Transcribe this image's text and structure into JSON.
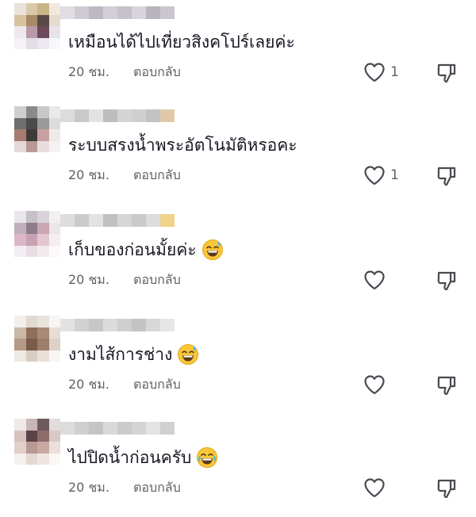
{
  "comments": [
    {
      "text": "เหมือนได้ไปเที่ยวสิงคโปร์เลยค่ะ",
      "time": "20 ชม.",
      "reply_label": "ตอบกลับ",
      "like_count": "1",
      "emoji": "",
      "avatar_colors": [
        "#e8e2d8",
        "#d9c9a8",
        "#c9b487",
        "#efe9df",
        "#d8c39c",
        "#a88a66",
        "#5a4a46",
        "#e6dbd0",
        "#efe8ee",
        "#b89aa8",
        "#6d4a5c",
        "#e8e3ea",
        "#f4f2f6",
        "#e3dde8",
        "#ece8f0",
        "#f8f7fa"
      ],
      "username_colors": [
        "#e0dde3",
        "#cfcad4",
        "#bdb8c2",
        "#d2cdd6",
        "#c6c1ca",
        "#d8d4dc",
        "#b9b4be",
        "#cac6ce"
      ]
    },
    {
      "text": "ระบบสรงน้ำพระอัตโนมัติหรอคะ",
      "time": "20 ชม.",
      "reply_label": "ตอบกลับ",
      "like_count": "1",
      "emoji": "",
      "avatar_colors": [
        "#cfcfcf",
        "#8a8a8a",
        "#c8c8c8",
        "#e9e9e9",
        "#6e6e6e",
        "#4a4a4a",
        "#9a9a9a",
        "#dcdcdc",
        "#a67c6e",
        "#3e3a3a",
        "#c9a0a0",
        "#efeaea",
        "#e6d8d8",
        "#b79a96",
        "#e9dede",
        "#f6f2f2"
      ],
      "username_colors": [
        "#dcdcdc",
        "#c9c9c9",
        "#e3e3e3",
        "#bdbdbd",
        "#d4d4d4",
        "#cfcfcf",
        "#c2c2c2",
        "#e0c9a8"
      ]
    },
    {
      "text": "เก็บของก่อนมั้ยค่ะ",
      "time": "20 ชม.",
      "reply_label": "ตอบกลับ",
      "like_count": "",
      "emoji": "sweat-smile",
      "avatar_colors": [
        "#e9e6ea",
        "#c7c0c8",
        "#d8d2d9",
        "#f2eff3",
        "#bfb1bc",
        "#8e7c8c",
        "#c9a7b4",
        "#ece5ea",
        "#d9b7c4",
        "#c8a2b2",
        "#e4c6d1",
        "#f4eef1",
        "#f3eef1",
        "#e8dde3",
        "#f1ebee",
        "#fbf9fa"
      ],
      "username_colors": [
        "#dddddd",
        "#cbcbcb",
        "#e2e2e2",
        "#c0c0c0",
        "#d6d6d6",
        "#cacaca",
        "#dcdcdc",
        "#f1d28a"
      ]
    },
    {
      "text": "งามไส้การช่าง",
      "time": "20 ชม.",
      "reply_label": "ตอบกลับ",
      "like_count": "",
      "emoji": "sweat-smile",
      "avatar_colors": [
        "#f2efec",
        "#e2d9d2",
        "#e9e3dd",
        "#f7f5f3",
        "#c9b7a8",
        "#8f6f5a",
        "#a88a76",
        "#e6ddd5",
        "#b59a86",
        "#7a5a48",
        "#9c7e6a",
        "#ddd2c8",
        "#efe9e4",
        "#d9ccc2",
        "#e8e0d9",
        "#f8f6f4"
      ],
      "username_colors": [
        "#e2e2e2",
        "#d1d1d1",
        "#c7c7c7",
        "#dbdbdb",
        "#cfcfcf",
        "#c3c3c3",
        "#d8d8d8",
        "#e6e6e6"
      ]
    },
    {
      "text": "ไปปิดน้ำก่อนครับ",
      "time": "20 ชม.",
      "reply_label": "ตอบกลับ",
      "like_count": "",
      "emoji": "joy",
      "avatar_colors": [
        "#efe9e9",
        "#c9b7b5",
        "#6e5a5e",
        "#e3dcdc",
        "#d7c2bd",
        "#5a4448",
        "#8e6c6a",
        "#d9c8c4",
        "#e2cfc9",
        "#b89892",
        "#c8a8a0",
        "#ebe0dc",
        "#f5efed",
        "#e5d8d3",
        "#efe6e2",
        "#faf7f6"
      ],
      "username_colors": [
        "#dcdcdc",
        "#cfcfcf",
        "#c4c4c4",
        "#d9d9d9",
        "#cbcbcb",
        "#d4d4d4",
        "#e3e3e3",
        "#d0d0d0"
      ]
    }
  ]
}
